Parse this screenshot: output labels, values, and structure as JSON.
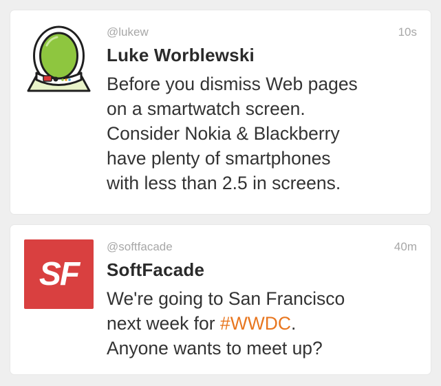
{
  "tweets": [
    {
      "handle": "@lukew",
      "time": "10s",
      "name": "Luke Worblewski",
      "avatar_icon": "astronaut-avatar-icon",
      "lines": [
        "Before you dismiss Web pages",
        "on a smartwatch screen.",
        "Consider Nokia & Blackberry",
        "have plenty of smartphones",
        "with less than 2.5 in screens."
      ]
    },
    {
      "handle": "@softfacade",
      "time": "40m",
      "name": "SoftFacade",
      "avatar_icon": "softfacade-logo-icon",
      "logo_text": "SF",
      "line1": "We're going to San Francisco",
      "line2_before": "next week for ",
      "hashtag": "#WWDC",
      "line2_after": ".",
      "line3": "Anyone wants to meet up?"
    }
  ],
  "colors": {
    "background": "#efefef",
    "card": "#ffffff",
    "meta_text": "#a7a7a7",
    "hashtag": "#e8761f",
    "logo_red": "#d94040"
  }
}
